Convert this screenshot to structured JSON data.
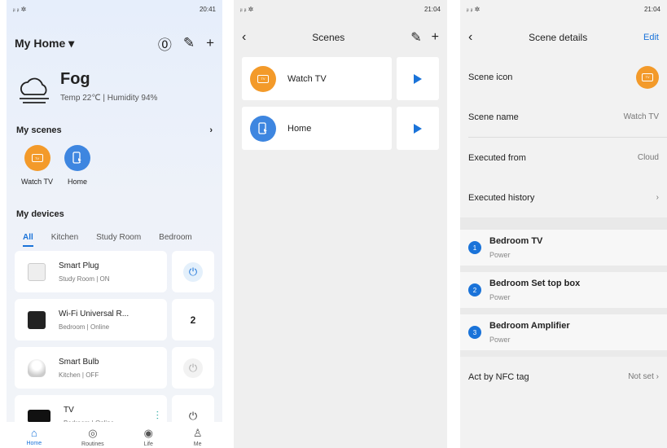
{
  "s1": {
    "status_left": "ᵢₗ ᵢₗ ✲",
    "status_right": "20:41",
    "home_title": "My Home ▾",
    "weather": {
      "condition": "Fog",
      "details": "Temp 22℃ | Humidity 94%"
    },
    "my_scenes_label": "My scenes",
    "scenes": [
      {
        "label": "Watch TV"
      },
      {
        "label": "Home"
      }
    ],
    "my_devices_label": "My devices",
    "tabs": [
      "All",
      "Kitchen",
      "Study Room",
      "Bedroom"
    ],
    "devices": [
      {
        "name": "Smart Plug",
        "sub": "Study Room | ON",
        "action": "⏻"
      },
      {
        "name": "Wi-Fi Universal R...",
        "sub": "Bedroom | Online",
        "action": "2"
      },
      {
        "name": "Smart Bulb",
        "sub": "Kitchen | OFF",
        "action": "⏻"
      },
      {
        "name": "TV",
        "sub": "Bedroom | Online",
        "action": "⏻"
      }
    ],
    "nav": [
      "Home",
      "Routines",
      "Life",
      "Me"
    ]
  },
  "s2": {
    "status_right": "21:04",
    "title": "Scenes",
    "scenes": [
      {
        "label": "Watch TV"
      },
      {
        "label": "Home"
      }
    ]
  },
  "s3": {
    "status_right": "21:04",
    "title": "Scene details",
    "edit": "Edit",
    "scene_icon_label": "Scene icon",
    "scene_name_label": "Scene name",
    "scene_name_value": "Watch TV",
    "executed_from_label": "Executed from",
    "executed_from_value": "Cloud",
    "executed_history_label": "Executed history",
    "actions": [
      {
        "num": "1",
        "name": "Bedroom TV",
        "sub": "Power"
      },
      {
        "num": "2",
        "name": "Bedroom Set top box",
        "sub": "Power"
      },
      {
        "num": "3",
        "name": "Bedroom Amplifier",
        "sub": "Power"
      }
    ],
    "nfc_label": "Act by NFC tag",
    "nfc_value": "Not set"
  },
  "colors": {
    "accent": "#1a73d9",
    "scene_orange": "#f39a2a",
    "scene_blue": "#3e86e0"
  }
}
